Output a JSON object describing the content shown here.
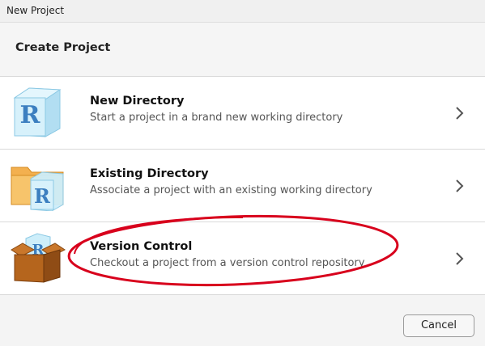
{
  "window": {
    "title": "New Project"
  },
  "header": {
    "title": "Create Project"
  },
  "options": [
    {
      "title": "New Directory",
      "description": "Start a project in a brand new working directory",
      "icon": "r-cube-icon"
    },
    {
      "title": "Existing Directory",
      "description": "Associate a project with an existing working directory",
      "icon": "folder-r-icon"
    },
    {
      "title": "Version Control",
      "description": "Checkout a project from a version control repository",
      "icon": "box-r-icon"
    }
  ],
  "footer": {
    "cancel_label": "Cancel"
  },
  "colors": {
    "highlight": "#d8001c",
    "r_cube": "#bfe5f5",
    "r_letter": "#3c7fc0",
    "folder": "#f0a94a",
    "box": "#b5651d"
  }
}
